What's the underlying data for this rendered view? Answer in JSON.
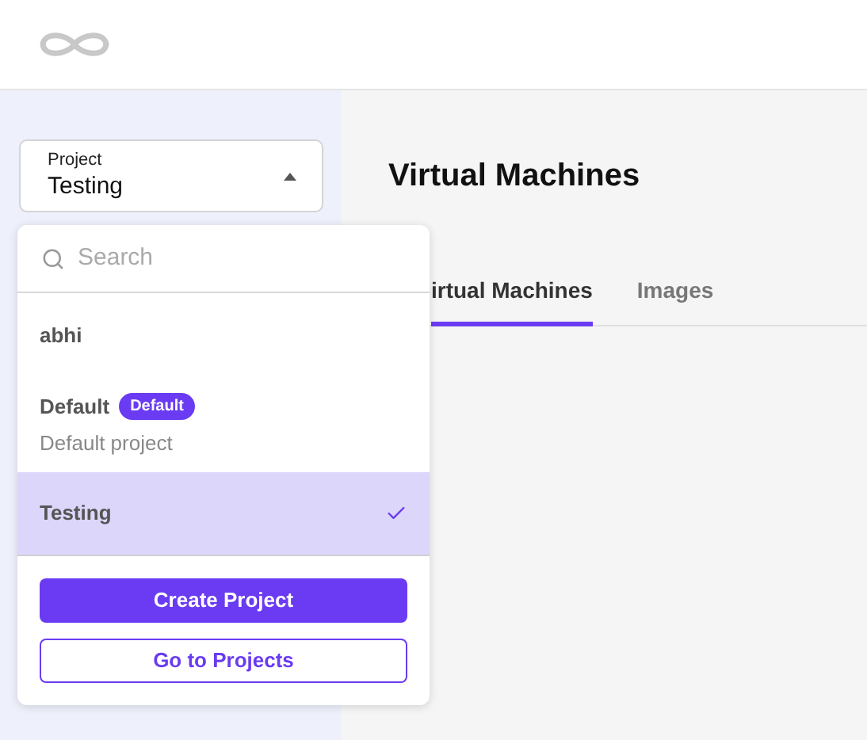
{
  "project_select": {
    "label": "Project",
    "value": "Testing",
    "expanded": true
  },
  "dropdown": {
    "search": {
      "placeholder": "Search"
    },
    "items": [
      {
        "name": "abhi",
        "selected": false
      },
      {
        "name": "Default",
        "badge": "Default",
        "description": "Default project",
        "selected": false
      },
      {
        "name": "Testing",
        "selected": true
      }
    ],
    "buttons": [
      {
        "label": "Create Project",
        "kind": "primary"
      },
      {
        "label": "Go to Projects",
        "kind": "outline"
      }
    ]
  },
  "page_title": "Virtual Machines",
  "tabs": [
    {
      "label": "irtual Machines",
      "selected": true
    },
    {
      "label": "Images",
      "selected": false
    }
  ]
}
